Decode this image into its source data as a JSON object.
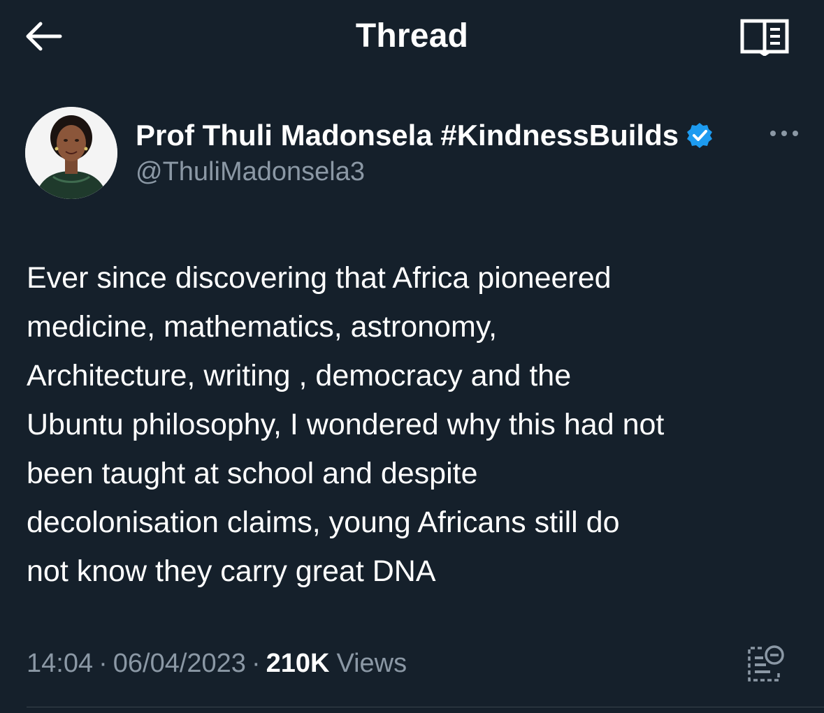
{
  "header": {
    "title": "Thread"
  },
  "author": {
    "display_name": "Prof Thuli Madonsela #KindnessBuilds",
    "handle": "@ThuliMadonsela3",
    "verified": true
  },
  "tweet": {
    "text": "Ever since discovering that Africa pioneered\nmedicine, mathematics, astronomy,\nArchitecture, writing , democracy and the\nUbuntu philosophy, I wondered why this had not\nbeen taught at school and despite\ndecolonisation claims, young Africans still do\nnot know they carry great DNA",
    "time": "14:04",
    "date": "06/04/2023",
    "separator": "·",
    "views_count": "210K",
    "views_label": "Views"
  },
  "icons": {
    "back": "arrow-left-icon",
    "reader": "book-open-icon",
    "verified": "verified-badge-icon",
    "more": "more-horizontal-icon",
    "analytics": "view-analytics-icon"
  },
  "colors": {
    "background": "#15202b",
    "text_primary": "#ffffff",
    "text_secondary": "#8b98a5",
    "verified_blue": "#1d9bf0",
    "divider": "#38444d"
  }
}
